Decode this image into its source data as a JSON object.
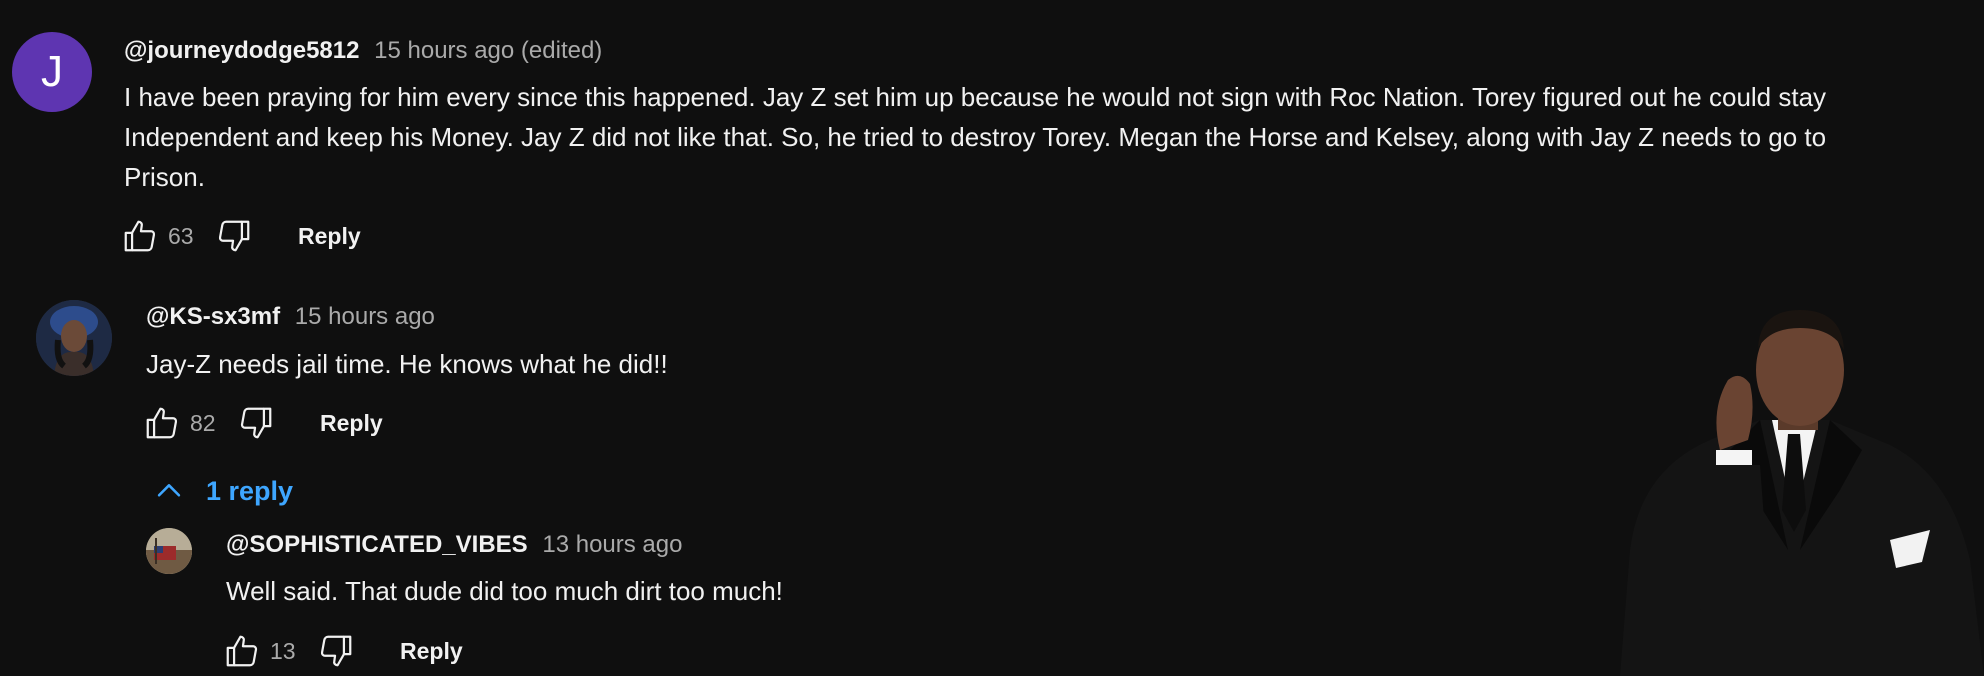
{
  "comments": [
    {
      "avatar_letter": "J",
      "avatar_color": "#5e35b1",
      "handle": "@journeydodge5812",
      "time": "15 hours ago (edited)",
      "lines": [
        "I have been praying for him every since this happened. Jay Z set him up because he would not sign with Roc Nation. Torey figured out he could stay",
        "Independent and keep his Money. Jay Z did not like that. So, he tried to destroy Torey. Megan the Horse and Kelsey, along with Jay Z needs to go to",
        "Prison."
      ],
      "likes": "63",
      "reply_label": "Reply"
    },
    {
      "handle": "@KS-sx3mf",
      "time": "15 hours ago",
      "text": "Jay-Z needs jail time. He knows what he did!!",
      "likes": "82",
      "reply_label": "Reply",
      "replies_toggle": "1 reply",
      "replies": [
        {
          "handle": "@SOPHISTICATED_VIBES",
          "time": "13 hours ago",
          "text": "Well said. That dude did too much dirt too much!",
          "likes": "13",
          "reply_label": "Reply"
        }
      ]
    }
  ],
  "colors": {
    "background": "#0f0f0f",
    "text_primary": "#f1f1f1",
    "text_secondary": "#aaaaaa",
    "link_blue": "#3ea6ff"
  },
  "icons": [
    "thumbs-up-icon",
    "thumbs-down-icon",
    "chevron-up-icon"
  ]
}
